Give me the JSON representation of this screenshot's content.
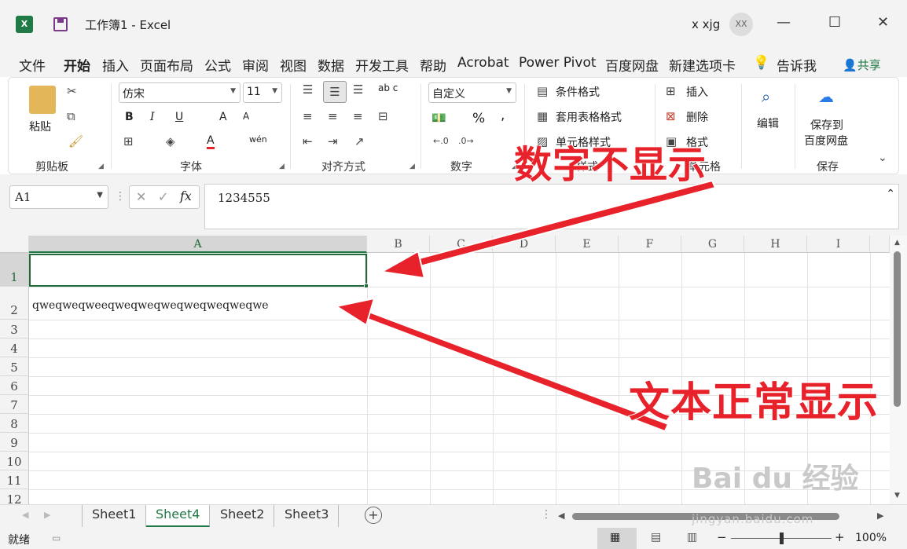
{
  "window": {
    "title": "工作簿1  -  Excel",
    "user": "x xjg",
    "avatar_initials": "XX",
    "app_icon": "X",
    "minimize": "—",
    "maximize": "☐",
    "close": "✕"
  },
  "menu": {
    "items": [
      "文件",
      "开始",
      "插入",
      "页面布局",
      "公式",
      "审阅",
      "视图",
      "数据",
      "开发工具",
      "帮助",
      "Acrobat",
      "Power Pivot",
      "百度网盘",
      "新建选项卡"
    ],
    "tell_me": "告诉我",
    "share": "共享"
  },
  "ribbon": {
    "clipboard": {
      "label": "剪贴板",
      "paste": "粘贴"
    },
    "font": {
      "label": "字体",
      "font_name": "仿宋",
      "font_size": "11",
      "bold": "B",
      "italic": "I",
      "underline": "U",
      "grow": "A",
      "shrink": "A",
      "font_color": "A",
      "phonetic": "wén"
    },
    "alignment": {
      "label": "对齐方式",
      "wrap": "ab c"
    },
    "number": {
      "label": "数字",
      "format": "自定义",
      "percent": "%",
      "comma": ","
    },
    "styles": {
      "conditional": "条件格式",
      "table": "套用表格格式",
      "cell_styles": "单元格样式",
      "label": "样式"
    },
    "cells": {
      "insert": "插入",
      "delete": "删除",
      "format": "格式",
      "label": "单元格"
    },
    "editing": {
      "label": "编辑"
    },
    "save": {
      "label": "保存",
      "line1": "保存到",
      "line2": "百度网盘"
    }
  },
  "formula_bar": {
    "name_box": "A1",
    "fx": "fx",
    "value": "1234555"
  },
  "sheet": {
    "columns": [
      "A",
      "B",
      "C",
      "D",
      "E",
      "F",
      "G",
      "H",
      "I"
    ],
    "rows": [
      "1",
      "2",
      "3",
      "4",
      "5",
      "6",
      "7",
      "8",
      "9",
      "10",
      "11",
      "12"
    ],
    "a2_text": "qweqweqweeqweqweqweqweqweqweqwe"
  },
  "tabs": [
    "Sheet1",
    "Sheet4",
    "Sheet2",
    "Sheet3"
  ],
  "active_tab": "Sheet4",
  "status": {
    "ready": "就绪",
    "zoom": "100%"
  },
  "annotations": {
    "top": "数字不显示",
    "bottom": "文本正常显示"
  },
  "watermark": {
    "brand": "Bai du 经验",
    "url": "jingyan.baidu.com"
  },
  "colors": {
    "excel_green": "#1f7a45",
    "annotation_red": "#e8222a"
  }
}
